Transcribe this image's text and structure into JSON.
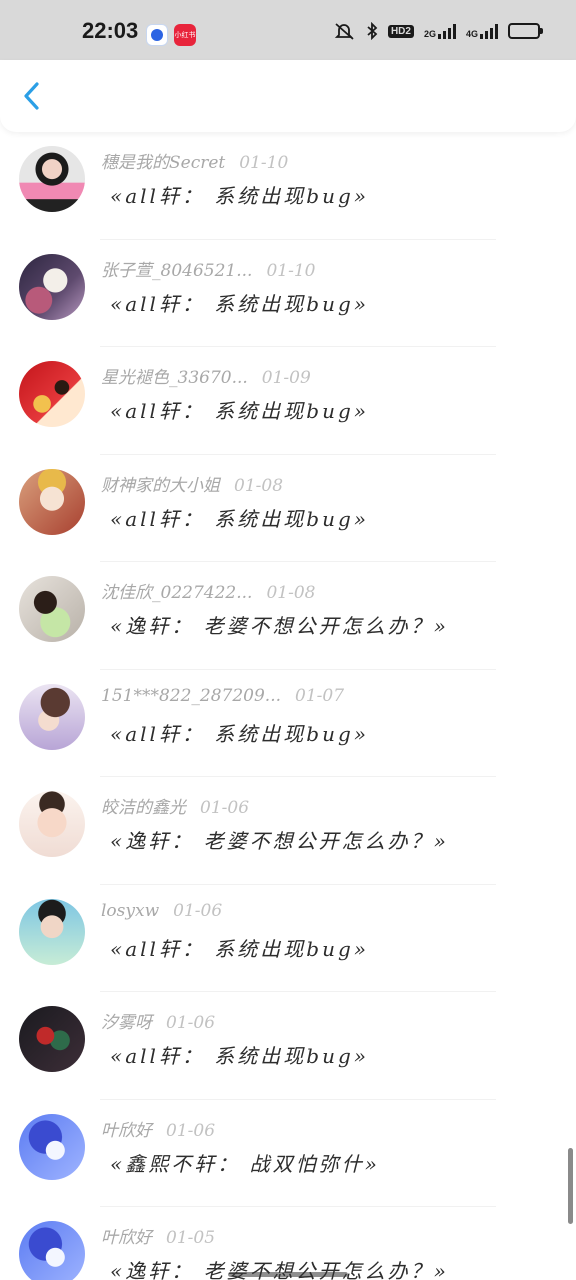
{
  "status_bar": {
    "time": "22:03",
    "red_app_label": "小红书",
    "network_hd": "HD2",
    "network_2g": "2G",
    "network_4g": "4G",
    "battery_level": 0.7,
    "battery_color": "#f4c21d"
  },
  "header": {
    "back_icon": "chevron-left-icon",
    "accent_color": "#2b9fe6"
  },
  "comments": [
    {
      "name": "穗是我的Secret",
      "date": "01-10",
      "text": "«all轩： 系统出现bug»"
    },
    {
      "name": "张子萱_8046521...",
      "date": "01-10",
      "text": "«all轩： 系统出现bug»"
    },
    {
      "name": "星光褪色_33670...",
      "date": "01-09",
      "text": "«all轩： 系统出现bug»"
    },
    {
      "name": "财神家的大小姐",
      "date": "01-08",
      "text": "«all轩： 系统出现bug»"
    },
    {
      "name": "沈佳欣_0227422...",
      "date": "01-08",
      "text": "«逸轩： 老婆不想公开怎么办？»"
    },
    {
      "name": "151***822_287209...",
      "date": "01-07",
      "text": "«all轩： 系统出现bug»"
    },
    {
      "name": "皎洁的鑫光",
      "date": "01-06",
      "text": "«逸轩： 老婆不想公开怎么办？»"
    },
    {
      "name": "losyxw",
      "date": "01-06",
      "text": "«all轩： 系统出现bug»"
    },
    {
      "name": "汐雾呀",
      "date": "01-06",
      "text": "«all轩： 系统出现bug»"
    },
    {
      "name": "叶欣好",
      "date": "01-06",
      "text": "«鑫熙不轩： 战双怕弥什»"
    },
    {
      "name": "叶欣好",
      "date": "01-05",
      "text": "«逸轩： 老婆不想公开怎么办？»"
    }
  ]
}
